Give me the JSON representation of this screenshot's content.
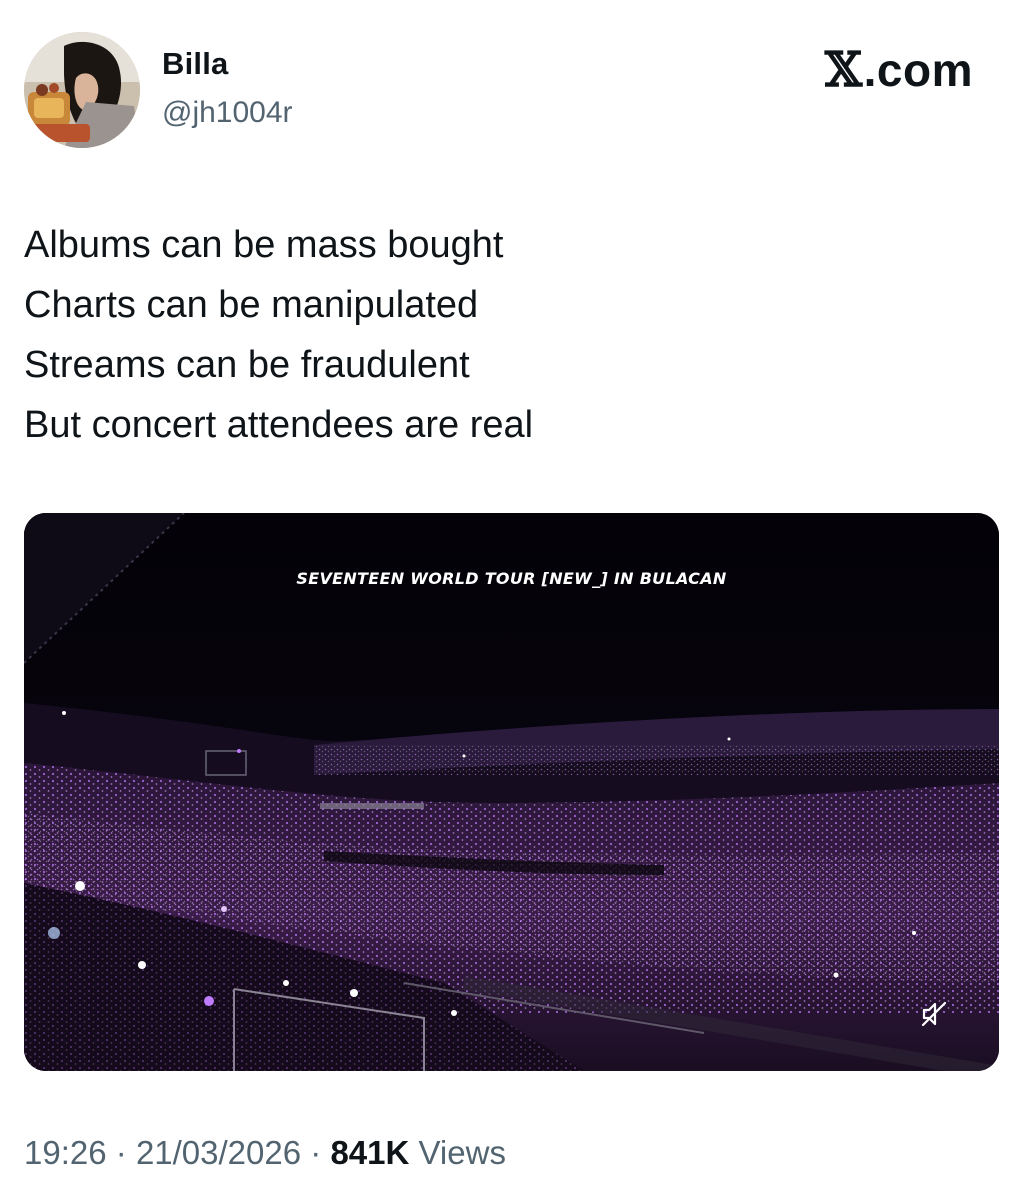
{
  "author": {
    "name": "Billa",
    "handle": "@jh1004r",
    "avatar_icon": "profile-photo"
  },
  "brand": {
    "x_glyph": "𝕏",
    "domain": ".com"
  },
  "tweet": {
    "lines": [
      "Albums can be mass bought",
      "Charts can be manipulated",
      "Streams can be fraudulent",
      "But concert attendees are real"
    ]
  },
  "media": {
    "caption": "SEVENTEEN WORLD TOUR [NEW_] IN BULACAN",
    "mute_icon": "speaker-muted-icon"
  },
  "meta": {
    "time": "19:26",
    "separator": "·",
    "date": "21/03/2026",
    "views_count": "841K",
    "views_label": "Views"
  },
  "colors": {
    "text_primary": "#0f1419",
    "text_secondary": "#536471",
    "lightstick_purple": "#b06cff"
  }
}
